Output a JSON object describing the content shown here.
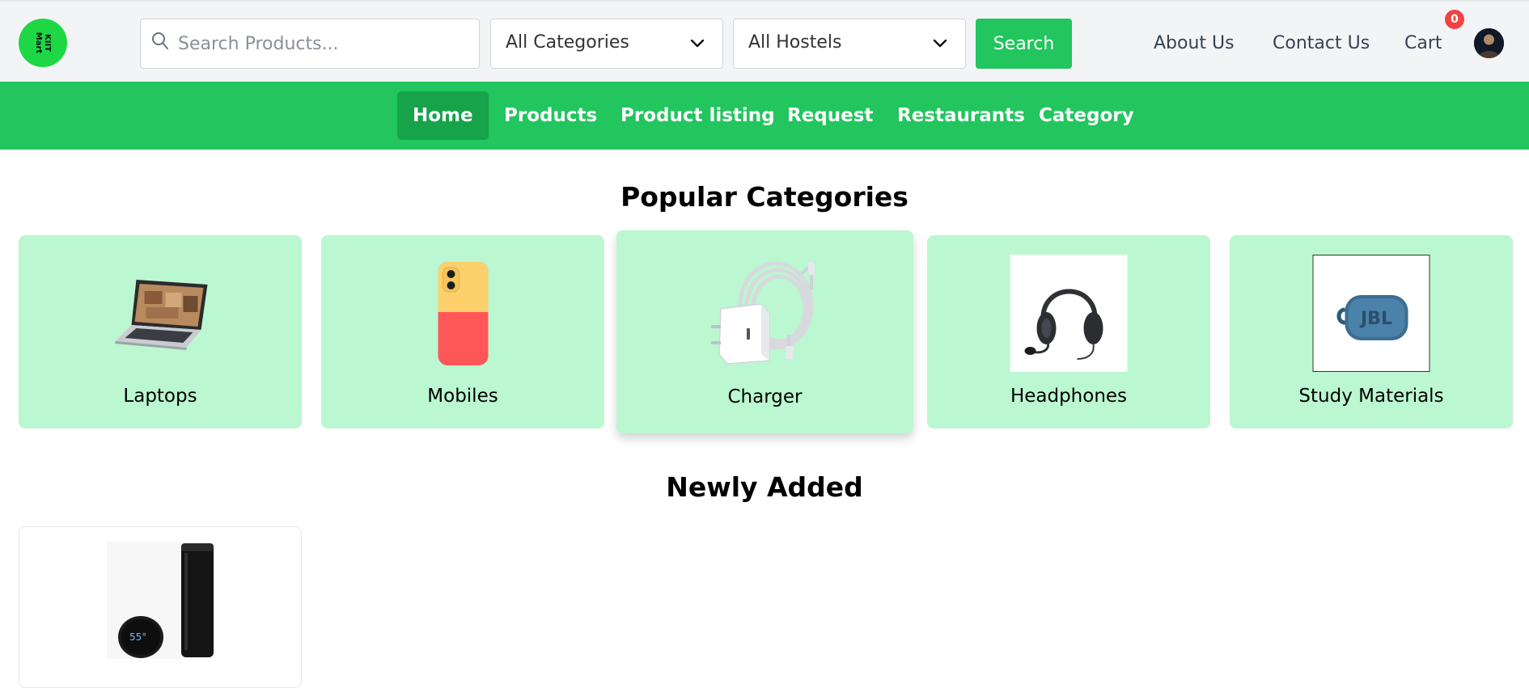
{
  "header": {
    "logo_text_line1": "KIIT",
    "logo_text_line2": "Mart",
    "search_placeholder": "Search Products...",
    "category_select": "All Categories",
    "hostel_select": "All Hostels",
    "search_button": "Search",
    "links": [
      "About Us",
      "Contact Us",
      "Cart"
    ],
    "cart_count": "0"
  },
  "nav": {
    "items": [
      "Home",
      "Products",
      "Product listing",
      "Request",
      "Restaurants",
      "Category"
    ],
    "active": "Home"
  },
  "popular": {
    "title": "Popular Categories",
    "categories": [
      "Laptops",
      "Mobiles",
      "Charger",
      "Headphones",
      "Study Materials"
    ]
  },
  "newly_added": {
    "title": "Newly Added",
    "thermo_display": "55°"
  },
  "colors": {
    "accent": "#22c55e",
    "nav_active": "#16a34a",
    "card_bg": "#bbf7d0",
    "badge": "#ef4444"
  },
  "icons": [
    "search-icon",
    "chevron-down-icon",
    "avatar"
  ]
}
